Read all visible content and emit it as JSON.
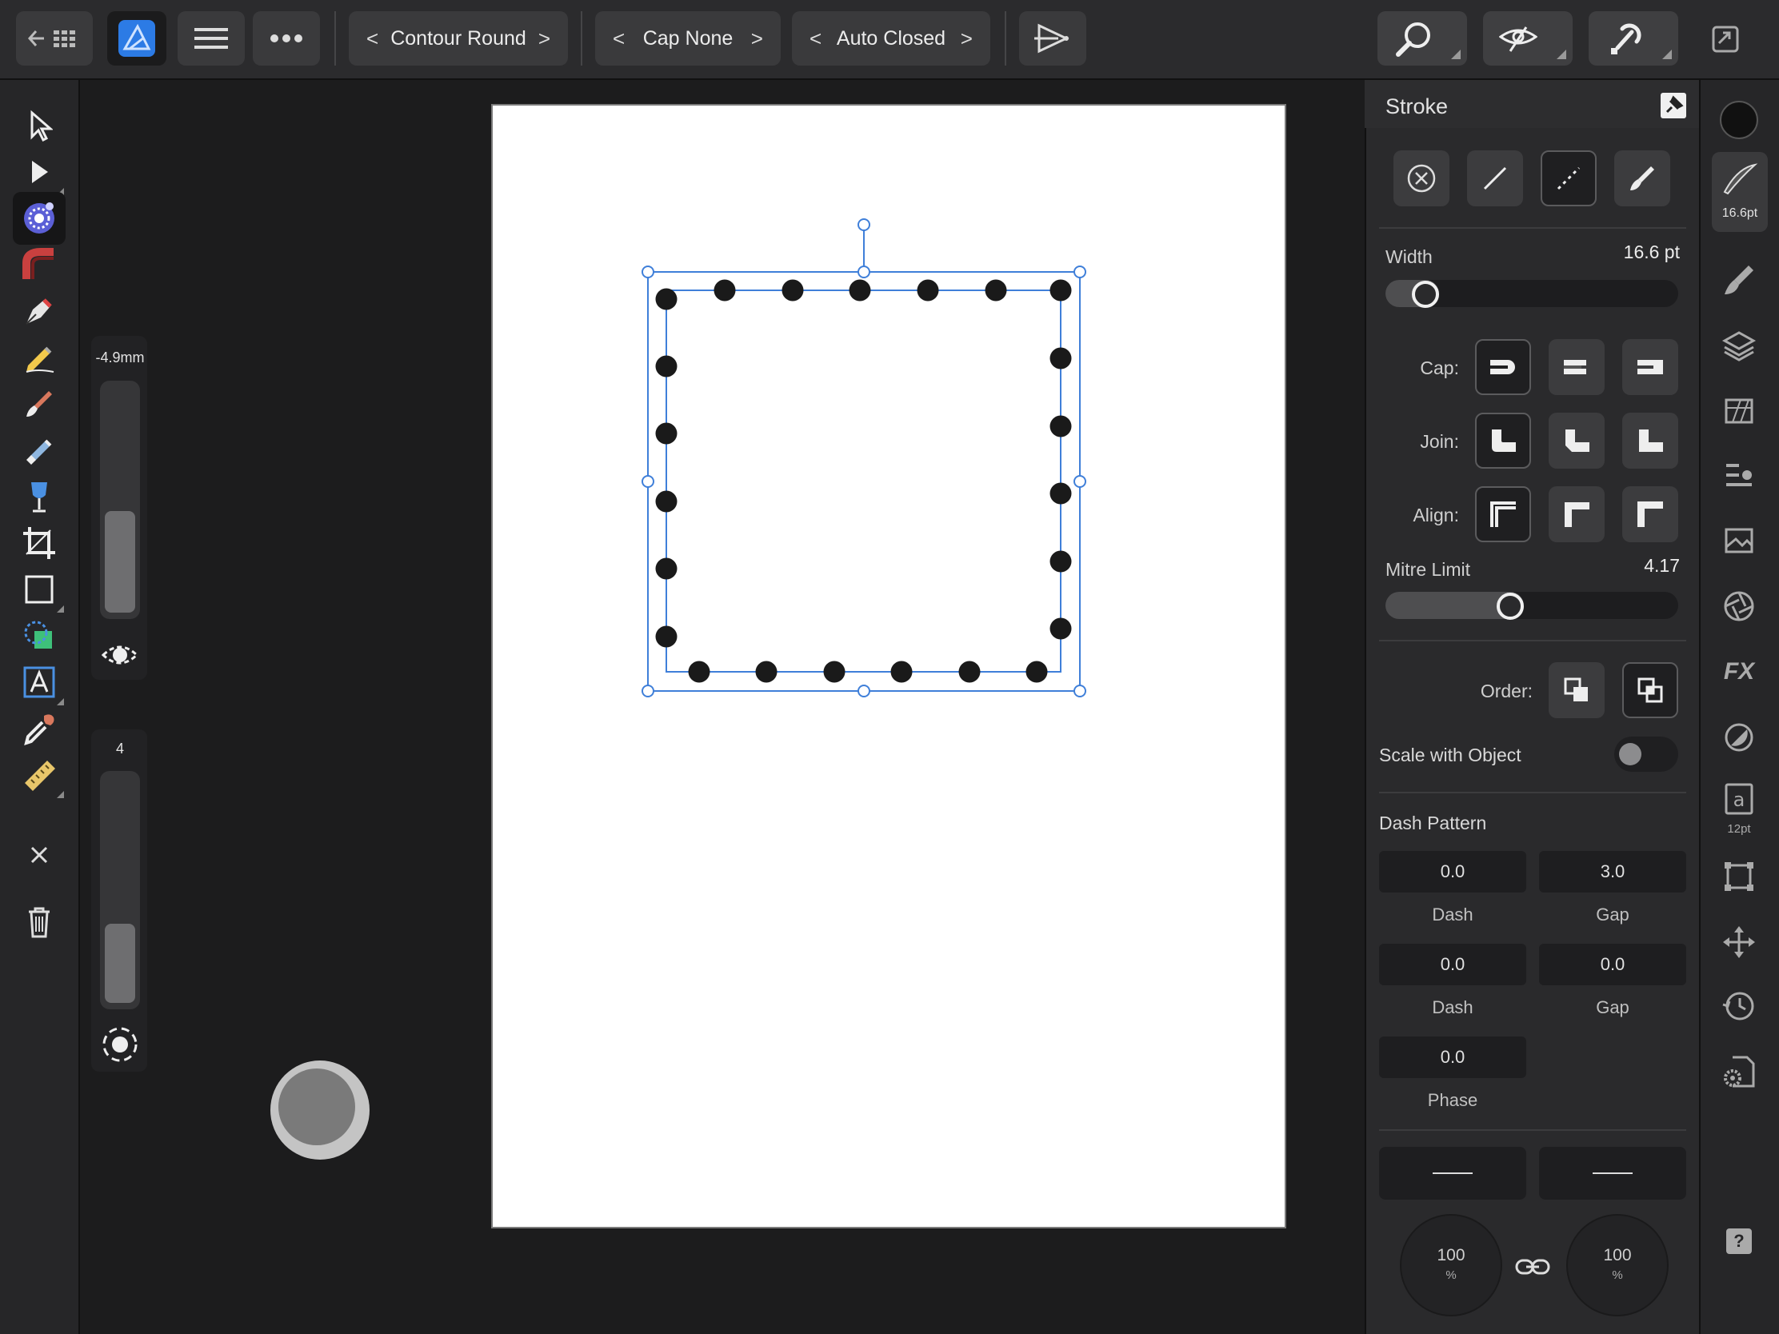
{
  "toolbar": {
    "back_icon": "back-grid-icon",
    "app_icon": "affinity-designer-icon",
    "menu_icon": "hamburger-menu-icon",
    "more_icon": "more-dots-icon",
    "stepper_join": {
      "prev": "<",
      "label": "Contour Round",
      "next": ">"
    },
    "stepper_cap": {
      "prev": "<",
      "label": "Cap None",
      "next": ">"
    },
    "stepper_closed": {
      "prev": "<",
      "label": "Auto Closed",
      "next": ">"
    },
    "send_icon": "send-triangle-icon"
  },
  "studio_top": [
    "zoom-icon",
    "view-mode-icon",
    "snapping-icon",
    "fullscreen-icon"
  ],
  "left_tools": [
    "move-tool",
    "node-tool",
    "contour-tool",
    "corner-tool",
    "pen-tool",
    "pencil-tool",
    "vector-brush-tool",
    "pixel-brush-tool",
    "fill-tool",
    "crop-tool",
    "rectangle-tool",
    "shape-builder-tool",
    "artistic-text-tool",
    "color-picker-tool",
    "measure-tool"
  ],
  "context": {
    "offset_value": "-4.9mm",
    "offset_fill": 0.45,
    "count_value": "4",
    "count_fill": 0.35
  },
  "stroke_panel": {
    "title": "Stroke",
    "width_label": "Width",
    "width_value": "16.6 pt",
    "width_slider": 0.1,
    "cap_label": "Cap:",
    "join_label": "Join:",
    "align_label": "Align:",
    "mitre_label": "Mitre Limit",
    "mitre_value": "4.17",
    "mitre_slider": 0.42,
    "order_label": "Order:",
    "scale_label": "Scale with Object",
    "scale_on": false,
    "dash_title": "Dash Pattern",
    "dash1": "0.0",
    "gap1": "3.0",
    "dash2": "0.0",
    "gap2": "0.0",
    "phase": "0.0",
    "dash_label": "Dash",
    "gap_label": "Gap",
    "phase_label": "Phase",
    "arrow_start": "100",
    "arrow_end": "100",
    "pct": "%"
  },
  "studio_strip": {
    "stroke_badge": "16.6pt",
    "text_badge": "12pt",
    "text_glyph": "a",
    "fx_label": "FX",
    "help_label": "?"
  },
  "colors": {
    "selection": "#3f7fd9",
    "accent": "#4a90e2"
  }
}
